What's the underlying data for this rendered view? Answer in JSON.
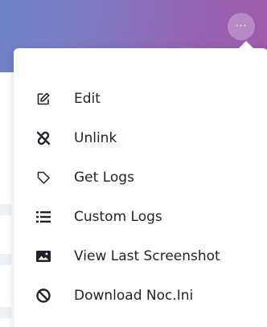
{
  "header": {
    "more_button_glyph": "···",
    "more_icon": "ellipsis-icon"
  },
  "menu": {
    "items": [
      {
        "label": "Edit",
        "icon": "edit-icon"
      },
      {
        "label": "Unlink",
        "icon": "unlink-icon"
      },
      {
        "label": "Get Logs",
        "icon": "tag-icon"
      },
      {
        "label": "Custom Logs",
        "icon": "list-icon"
      },
      {
        "label": "View Last Screenshot",
        "icon": "image-icon"
      },
      {
        "label": "Download Noc.Ini",
        "icon": "block-icon"
      }
    ]
  },
  "colors": {
    "banner_start": "#6d83c9",
    "banner_end": "#a05aab",
    "text": "#1f2328",
    "icon": "#1f2328"
  }
}
